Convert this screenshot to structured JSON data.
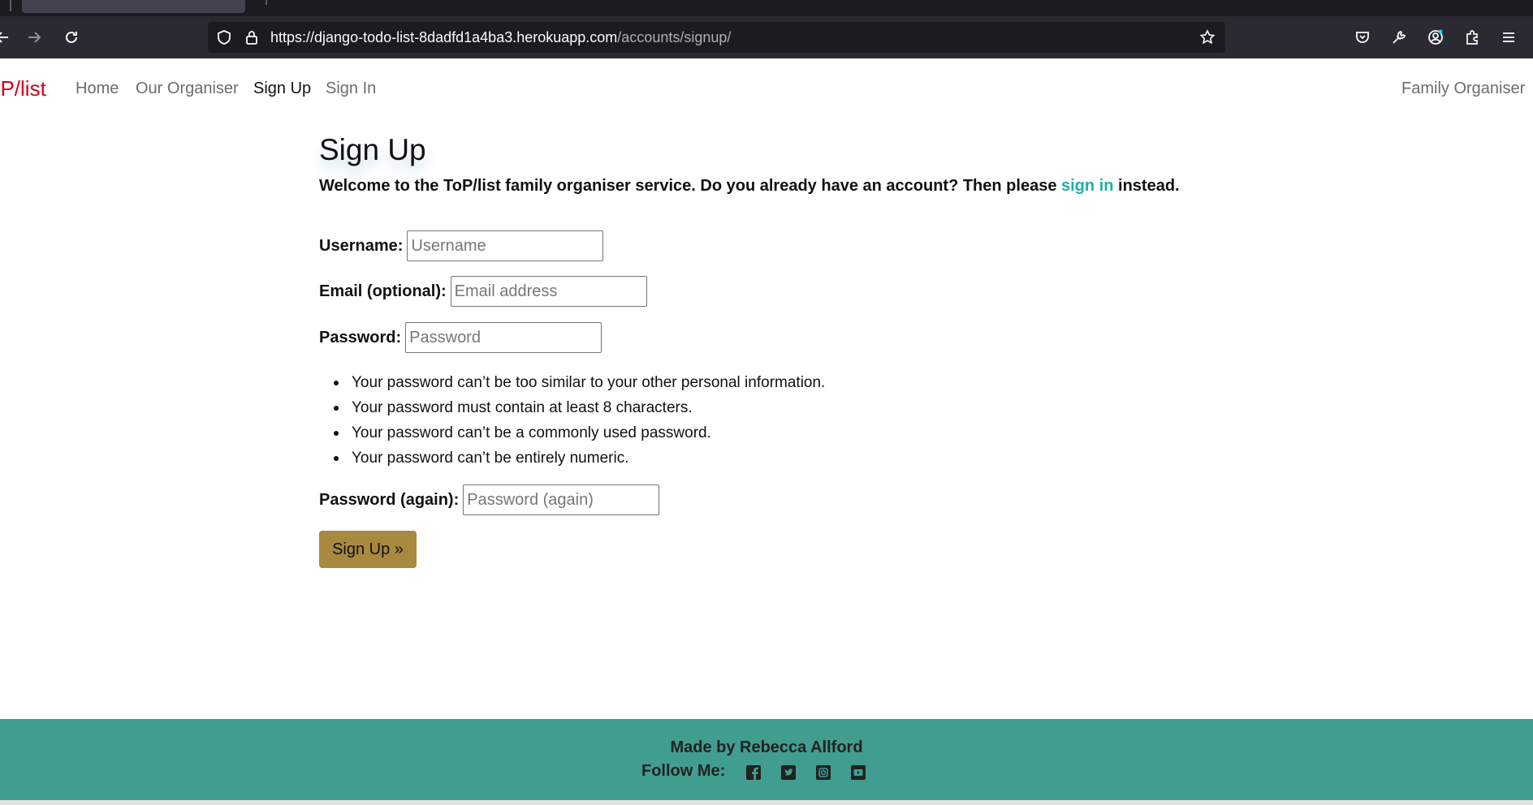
{
  "browser": {
    "url_main": "https://django-todo-list-8dadfd1a4ba3.herokuapp.com",
    "url_path": "/accounts/signup/"
  },
  "nav": {
    "brand": "oP/list",
    "links": [
      "Home",
      "Our Organiser",
      "Sign Up",
      "Sign In"
    ],
    "right": "Family Organiser"
  },
  "form": {
    "title": "Sign Up",
    "intro_before": "Welcome to the ToP/list family organiser service. Do you already have an account? Then please ",
    "intro_link": "sign in",
    "intro_after": " instead.",
    "username_label": "Username:",
    "username_placeholder": "Username",
    "email_label": "Email (optional):",
    "email_placeholder": "Email address",
    "password_label": "Password:",
    "password_placeholder": "Password",
    "help": [
      "Your password can’t be too similar to your other personal information.",
      "Your password must contain at least 8 characters.",
      "Your password can’t be a commonly used password.",
      "Your password can’t be entirely numeric."
    ],
    "password2_label": "Password (again):",
    "password2_placeholder": "Password (again)",
    "submit": "Sign Up »"
  },
  "footer": {
    "made_by": "Made by Rebecca Allford",
    "follow": "Follow Me:",
    "social_icons": [
      "facebook-icon",
      "twitter-icon",
      "instagram-icon",
      "youtube-icon"
    ]
  },
  "colors": {
    "brand": "#d5001c",
    "link": "#1fb0a6",
    "button": "#a8893e",
    "footer": "#429d91"
  }
}
